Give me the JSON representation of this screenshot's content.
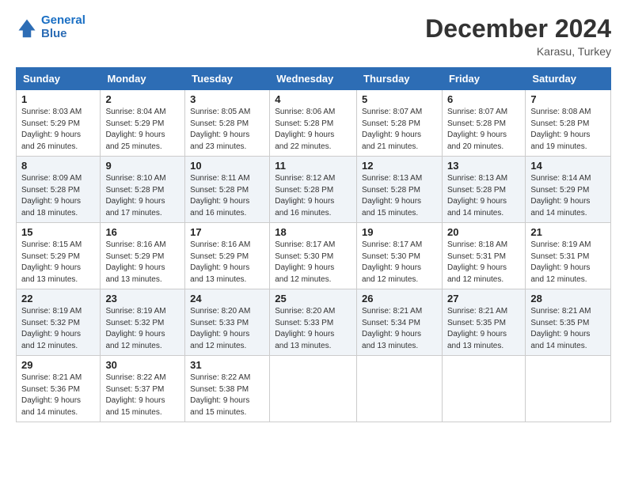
{
  "logo": {
    "line1": "General",
    "line2": "Blue"
  },
  "title": "December 2024",
  "subtitle": "Karasu, Turkey",
  "header_days": [
    "Sunday",
    "Monday",
    "Tuesday",
    "Wednesday",
    "Thursday",
    "Friday",
    "Saturday"
  ],
  "weeks": [
    [
      {
        "day": "1",
        "info": "Sunrise: 8:03 AM\nSunset: 5:29 PM\nDaylight: 9 hours\nand 26 minutes."
      },
      {
        "day": "2",
        "info": "Sunrise: 8:04 AM\nSunset: 5:29 PM\nDaylight: 9 hours\nand 25 minutes."
      },
      {
        "day": "3",
        "info": "Sunrise: 8:05 AM\nSunset: 5:28 PM\nDaylight: 9 hours\nand 23 minutes."
      },
      {
        "day": "4",
        "info": "Sunrise: 8:06 AM\nSunset: 5:28 PM\nDaylight: 9 hours\nand 22 minutes."
      },
      {
        "day": "5",
        "info": "Sunrise: 8:07 AM\nSunset: 5:28 PM\nDaylight: 9 hours\nand 21 minutes."
      },
      {
        "day": "6",
        "info": "Sunrise: 8:07 AM\nSunset: 5:28 PM\nDaylight: 9 hours\nand 20 minutes."
      },
      {
        "day": "7",
        "info": "Sunrise: 8:08 AM\nSunset: 5:28 PM\nDaylight: 9 hours\nand 19 minutes."
      }
    ],
    [
      {
        "day": "8",
        "info": "Sunrise: 8:09 AM\nSunset: 5:28 PM\nDaylight: 9 hours\nand 18 minutes."
      },
      {
        "day": "9",
        "info": "Sunrise: 8:10 AM\nSunset: 5:28 PM\nDaylight: 9 hours\nand 17 minutes."
      },
      {
        "day": "10",
        "info": "Sunrise: 8:11 AM\nSunset: 5:28 PM\nDaylight: 9 hours\nand 16 minutes."
      },
      {
        "day": "11",
        "info": "Sunrise: 8:12 AM\nSunset: 5:28 PM\nDaylight: 9 hours\nand 16 minutes."
      },
      {
        "day": "12",
        "info": "Sunrise: 8:13 AM\nSunset: 5:28 PM\nDaylight: 9 hours\nand 15 minutes."
      },
      {
        "day": "13",
        "info": "Sunrise: 8:13 AM\nSunset: 5:28 PM\nDaylight: 9 hours\nand 14 minutes."
      },
      {
        "day": "14",
        "info": "Sunrise: 8:14 AM\nSunset: 5:29 PM\nDaylight: 9 hours\nand 14 minutes."
      }
    ],
    [
      {
        "day": "15",
        "info": "Sunrise: 8:15 AM\nSunset: 5:29 PM\nDaylight: 9 hours\nand 13 minutes."
      },
      {
        "day": "16",
        "info": "Sunrise: 8:16 AM\nSunset: 5:29 PM\nDaylight: 9 hours\nand 13 minutes."
      },
      {
        "day": "17",
        "info": "Sunrise: 8:16 AM\nSunset: 5:29 PM\nDaylight: 9 hours\nand 13 minutes."
      },
      {
        "day": "18",
        "info": "Sunrise: 8:17 AM\nSunset: 5:30 PM\nDaylight: 9 hours\nand 12 minutes."
      },
      {
        "day": "19",
        "info": "Sunrise: 8:17 AM\nSunset: 5:30 PM\nDaylight: 9 hours\nand 12 minutes."
      },
      {
        "day": "20",
        "info": "Sunrise: 8:18 AM\nSunset: 5:31 PM\nDaylight: 9 hours\nand 12 minutes."
      },
      {
        "day": "21",
        "info": "Sunrise: 8:19 AM\nSunset: 5:31 PM\nDaylight: 9 hours\nand 12 minutes."
      }
    ],
    [
      {
        "day": "22",
        "info": "Sunrise: 8:19 AM\nSunset: 5:32 PM\nDaylight: 9 hours\nand 12 minutes."
      },
      {
        "day": "23",
        "info": "Sunrise: 8:19 AM\nSunset: 5:32 PM\nDaylight: 9 hours\nand 12 minutes."
      },
      {
        "day": "24",
        "info": "Sunrise: 8:20 AM\nSunset: 5:33 PM\nDaylight: 9 hours\nand 12 minutes."
      },
      {
        "day": "25",
        "info": "Sunrise: 8:20 AM\nSunset: 5:33 PM\nDaylight: 9 hours\nand 13 minutes."
      },
      {
        "day": "26",
        "info": "Sunrise: 8:21 AM\nSunset: 5:34 PM\nDaylight: 9 hours\nand 13 minutes."
      },
      {
        "day": "27",
        "info": "Sunrise: 8:21 AM\nSunset: 5:35 PM\nDaylight: 9 hours\nand 13 minutes."
      },
      {
        "day": "28",
        "info": "Sunrise: 8:21 AM\nSunset: 5:35 PM\nDaylight: 9 hours\nand 14 minutes."
      }
    ],
    [
      {
        "day": "29",
        "info": "Sunrise: 8:21 AM\nSunset: 5:36 PM\nDaylight: 9 hours\nand 14 minutes."
      },
      {
        "day": "30",
        "info": "Sunrise: 8:22 AM\nSunset: 5:37 PM\nDaylight: 9 hours\nand 15 minutes."
      },
      {
        "day": "31",
        "info": "Sunrise: 8:22 AM\nSunset: 5:38 PM\nDaylight: 9 hours\nand 15 minutes."
      },
      null,
      null,
      null,
      null
    ]
  ]
}
